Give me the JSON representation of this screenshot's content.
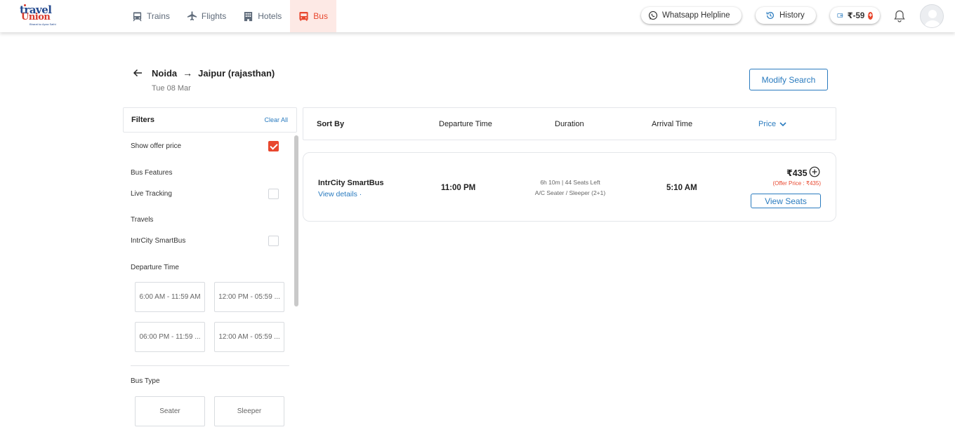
{
  "brand": {
    "logo_top": "travel",
    "logo_bottom": "Union",
    "logo_tagline": "Bharat ko Apna Sathi"
  },
  "nav": {
    "items": [
      {
        "label": "Trains",
        "icon": "train-icon"
      },
      {
        "label": "Flights",
        "icon": "plane-icon"
      },
      {
        "label": "Hotels",
        "icon": "hotel-icon"
      },
      {
        "label": "Bus",
        "icon": "bus-icon",
        "active": true
      }
    ]
  },
  "header": {
    "whatsapp_label": "Whatsapp Helpline",
    "history_label": "History",
    "wallet_amount": "₹-59"
  },
  "route": {
    "from": "Noida",
    "to": "Jaipur (rajasthan)",
    "date": "Tue 08 Mar",
    "modify_label": "Modify Search"
  },
  "filters": {
    "title": "Filters",
    "clear_label": "Clear All",
    "show_offer_price": {
      "label": "Show offer price",
      "checked": true
    },
    "bus_features_heading": "Bus Features",
    "live_tracking": {
      "label": "Live Tracking",
      "checked": false
    },
    "travels_heading": "Travels",
    "intrcity": {
      "label": "IntrCity SmartBus",
      "checked": false
    },
    "departure_heading": "Departure Time",
    "departure_slots": [
      "6:00 AM - 11:59 AM",
      "12:00 PM - 05:59 ...",
      "06:00 PM - 11:59 ...",
      "12:00 AM - 05:59 ..."
    ],
    "bus_type_heading": "Bus Type",
    "bus_types": [
      "Seater",
      "Sleeper"
    ]
  },
  "sort": {
    "sort_by": "Sort By",
    "departure": "Departure Time",
    "duration": "Duration",
    "arrival": "Arrival Time",
    "price": "Price"
  },
  "results": [
    {
      "operator": "IntrCity SmartBus",
      "view_details": "View details",
      "departure": "11:00 PM",
      "duration_seats": "6h 10m | 44 Seats Left",
      "bus_type": "A/C Seater / Sleeper (2+1)",
      "arrival": "5:10 AM",
      "price": "₹435",
      "offer_price": "(Offer Price : ₹435)",
      "view_seats_label": "View Seats"
    }
  ],
  "colors": {
    "accent": "#e8472e",
    "link": "#2a7bbf",
    "active_tab_bg": "#fde9e5"
  }
}
